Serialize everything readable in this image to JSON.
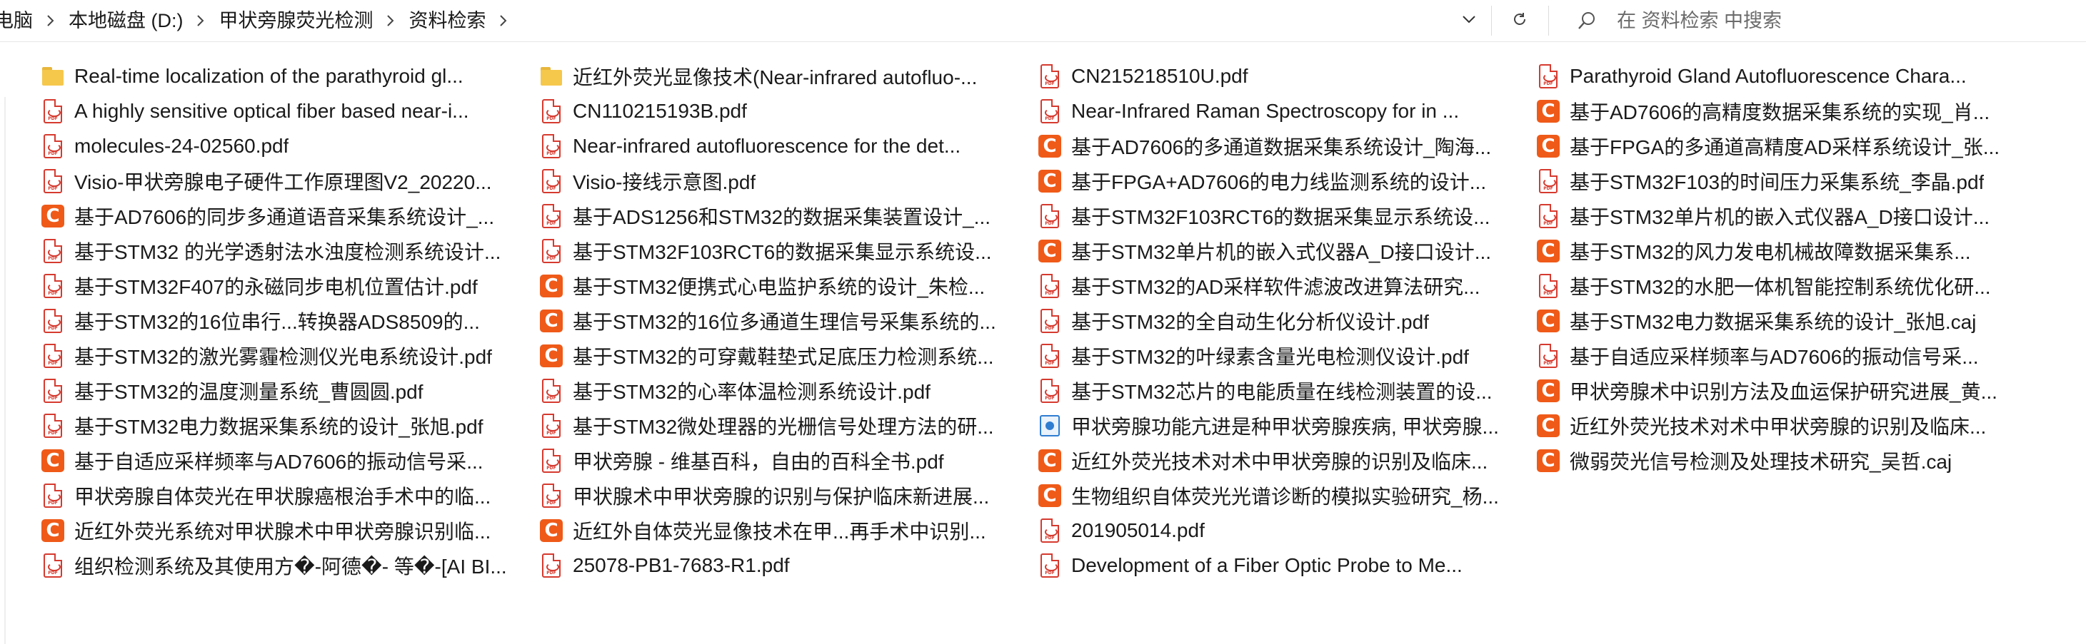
{
  "breadcrumb": [
    "电脑",
    "本地磁盘 (D:)",
    "甲状旁腺荧光检测",
    "资料检索"
  ],
  "search": {
    "placeholder": "在 资料检索 中搜索",
    "value": ""
  },
  "icons": {
    "chevron_down": "chevron-down-icon",
    "refresh": "refresh-icon",
    "search": "search-icon",
    "separator": "chevron-right-icon",
    "folder": "folder-icon",
    "pdf": "pdf-file-icon",
    "caj": "caj-file-icon",
    "web": "web-file-icon"
  },
  "colors": {
    "pdf": "#d63a2f",
    "caj": "#ef5a19",
    "folder": "#f5c84c",
    "web": "#2f7dd1"
  },
  "files": [
    {
      "name": "Real-time localization of the parathyroid gl...",
      "type": "folder"
    },
    {
      "name": "A highly sensitive optical fiber based near-i...",
      "type": "pdf"
    },
    {
      "name": "molecules-24-02560.pdf",
      "type": "pdf"
    },
    {
      "name": "Visio-甲状旁腺电子硬件工作原理图V2_20220...",
      "type": "pdf"
    },
    {
      "name": "基于AD7606的同步多通道语音采集系统设计_...",
      "type": "caj"
    },
    {
      "name": "基于STM32 的光学透射法水浊度检测系统设计...",
      "type": "pdf"
    },
    {
      "name": "基于STM32F407的永磁同步电机位置估计.pdf",
      "type": "pdf"
    },
    {
      "name": "基于STM32的16位串行...转换器ADS8509的...",
      "type": "pdf"
    },
    {
      "name": "基于STM32的激光雾霾检测仪光电系统设计.pdf",
      "type": "pdf"
    },
    {
      "name": "基于STM32的温度测量系统_曹圆圆.pdf",
      "type": "pdf"
    },
    {
      "name": "基于STM32电力数据采集系统的设计_张旭.pdf",
      "type": "pdf"
    },
    {
      "name": "基于自适应采样频率与AD7606的振动信号采...",
      "type": "caj"
    },
    {
      "name": "甲状旁腺自体荧光在甲状腺癌根治手术中的临...",
      "type": "pdf"
    },
    {
      "name": "近红外荧光系统对甲状腺术中甲状旁腺识别临...",
      "type": "caj"
    },
    {
      "name": "组织检测系统及其使用方�-阿德�- 等�-[AI BI...",
      "type": "pdf"
    },
    {
      "name": "近红外荧光显像技术(Near-infrared autofluo-...",
      "type": "folder"
    },
    {
      "name": "CN110215193B.pdf",
      "type": "pdf"
    },
    {
      "name": "Near-infrared autofluorescence for the det...",
      "type": "pdf"
    },
    {
      "name": "Visio-接线示意图.pdf",
      "type": "pdf"
    },
    {
      "name": "基于ADS1256和STM32的数据采集装置设计_...",
      "type": "pdf"
    },
    {
      "name": "基于STM32F103RCT6的数据采集显示系统设...",
      "type": "pdf"
    },
    {
      "name": "基于STM32便携式心电监护系统的设计_朱检...",
      "type": "caj"
    },
    {
      "name": "基于STM32的16位多通道生理信号采集系统的...",
      "type": "caj"
    },
    {
      "name": "基于STM32的可穿戴鞋垫式足底压力检测系统...",
      "type": "caj"
    },
    {
      "name": "基于STM32的心率体温检测系统设计.pdf",
      "type": "pdf"
    },
    {
      "name": "基于STM32微处理器的光栅信号处理方法的研...",
      "type": "pdf"
    },
    {
      "name": "甲状旁腺 - 维基百科，自由的百科全书.pdf",
      "type": "pdf"
    },
    {
      "name": "甲状腺术中甲状旁腺的识别与保护临床新进展...",
      "type": "pdf"
    },
    {
      "name": "近红外自体荧光显像技术在甲...再手术中识别...",
      "type": "caj"
    },
    {
      "name": "25078-PB1-7683-R1.pdf",
      "type": "pdf"
    },
    {
      "name": "CN215218510U.pdf",
      "type": "pdf"
    },
    {
      "name": "Near-Infrared Raman Spectroscopy for in ...",
      "type": "pdf"
    },
    {
      "name": "基于AD7606的多通道数据采集系统设计_陶海...",
      "type": "caj"
    },
    {
      "name": "基于FPGA+AD7606的电力线监测系统的设计...",
      "type": "caj"
    },
    {
      "name": "基于STM32F103RCT6的数据采集显示系统设...",
      "type": "pdf"
    },
    {
      "name": "基于STM32单片机的嵌入式仪器A_D接口设计...",
      "type": "caj"
    },
    {
      "name": "基于STM32的AD采样软件滤波改进算法研究...",
      "type": "pdf"
    },
    {
      "name": "基于STM32的全自动生化分析仪设计.pdf",
      "type": "pdf"
    },
    {
      "name": "基于STM32的叶绿素含量光电检测仪设计.pdf",
      "type": "pdf"
    },
    {
      "name": "基于STM32芯片的电能质量在线检测装置的设...",
      "type": "pdf"
    },
    {
      "name": "甲状旁腺功能亢进是种甲状旁腺疾病, 甲状旁腺...",
      "type": "web"
    },
    {
      "name": "近红外荧光技术对术中甲状旁腺的识别及临床...",
      "type": "caj"
    },
    {
      "name": "生物组织自体荧光光谱诊断的模拟实验研究_杨...",
      "type": "caj"
    },
    {
      "name": "201905014.pdf",
      "type": "pdf"
    },
    {
      "name": "Development of a Fiber Optic Probe to Me...",
      "type": "pdf"
    },
    {
      "name": "Parathyroid Gland Autofluorescence Chara...",
      "type": "pdf"
    },
    {
      "name": "基于AD7606的高精度数据采集系统的实现_肖...",
      "type": "caj"
    },
    {
      "name": "基于FPGA的多通道高精度AD采样系统设计_张...",
      "type": "caj"
    },
    {
      "name": "基于STM32F103的时间压力采集系统_李晶.pdf",
      "type": "pdf"
    },
    {
      "name": "基于STM32单片机的嵌入式仪器A_D接口设计...",
      "type": "pdf"
    },
    {
      "name": "基于STM32的风力发电机械故障数据采集系...",
      "type": "caj"
    },
    {
      "name": "基于STM32的水肥一体机智能控制系统优化研...",
      "type": "pdf"
    },
    {
      "name": "基于STM32电力数据采集系统的设计_张旭.caj",
      "type": "caj"
    },
    {
      "name": "基于自适应采样频率与AD7606的振动信号采...",
      "type": "pdf"
    },
    {
      "name": "甲状旁腺术中识别方法及血运保护研究进展_黄...",
      "type": "caj"
    },
    {
      "name": "近红外荧光技术对术中甲状旁腺的识别及临床...",
      "type": "caj"
    },
    {
      "name": "微弱荧光信号检测及处理技术研究_吴哲.caj",
      "type": "caj"
    }
  ]
}
